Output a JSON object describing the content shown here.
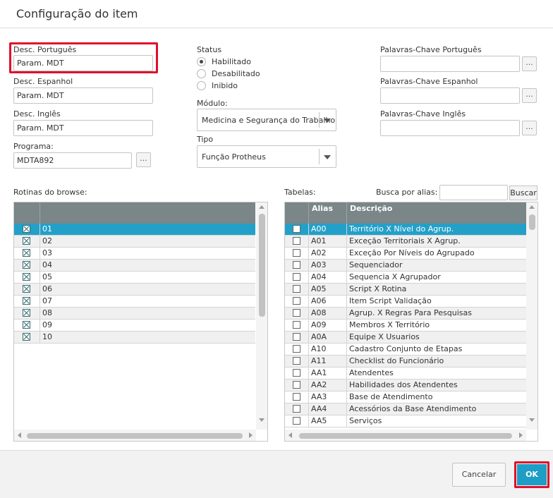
{
  "dialog": {
    "title": "Configuração do item"
  },
  "form": {
    "desc_pt": {
      "label": "Desc. Português",
      "value": "Param. MDT"
    },
    "desc_es": {
      "label": "Desc. Espanhol",
      "value": "Param. MDT"
    },
    "desc_en": {
      "label": "Desc. Inglês",
      "value": "Param. MDT"
    },
    "programa": {
      "label": "Programa:",
      "value": "MDTA892",
      "lookup": "..."
    },
    "status": {
      "label": "Status",
      "options": [
        "Habilitado",
        "Desabilitado",
        "Inibido"
      ],
      "selected": "Habilitado"
    },
    "modulo": {
      "label": "Módulo:",
      "value": "Medicina e Segurança do Trabalho"
    },
    "tipo": {
      "label": "Tipo",
      "value": "Função Protheus"
    },
    "kw_pt": {
      "label": "Palavras-Chave Português",
      "value": "",
      "lookup": "..."
    },
    "kw_es": {
      "label": "Palavras-Chave Espanhol",
      "value": "",
      "lookup": "..."
    },
    "kw_en": {
      "label": "Palavras-Chave Inglês",
      "value": "",
      "lookup": "..."
    }
  },
  "rotinas": {
    "label": "Rotinas do browse:",
    "rows": [
      {
        "value": "01",
        "checked": true,
        "selected": true
      },
      {
        "value": "02",
        "checked": true
      },
      {
        "value": "03",
        "checked": true
      },
      {
        "value": "04",
        "checked": true
      },
      {
        "value": "05",
        "checked": true
      },
      {
        "value": "06",
        "checked": true
      },
      {
        "value": "07",
        "checked": true
      },
      {
        "value": "08",
        "checked": true
      },
      {
        "value": "09",
        "checked": true
      },
      {
        "value": "10",
        "checked": true
      }
    ]
  },
  "tabelas": {
    "label": "Tabelas:",
    "search_label": "Busca por alias:",
    "search_value": "",
    "search_button": "Buscar",
    "columns": {
      "alias": "Alias",
      "descricao": "Descrição"
    },
    "rows": [
      {
        "alias": "A00",
        "descricao": "Território X Nível do Agrup.",
        "selected": true
      },
      {
        "alias": "A01",
        "descricao": "Exceção Territoriais X Agrup."
      },
      {
        "alias": "A02",
        "descricao": "Exceção Por Níveis do Agrupado"
      },
      {
        "alias": "A03",
        "descricao": "Sequenciador"
      },
      {
        "alias": "A04",
        "descricao": "Sequencia X Agrupador"
      },
      {
        "alias": "A05",
        "descricao": "Script X Rotina"
      },
      {
        "alias": "A06",
        "descricao": "Item Script Validação"
      },
      {
        "alias": "A08",
        "descricao": "Agrup. X Regras Para Pesquisas"
      },
      {
        "alias": "A09",
        "descricao": "Membros X Território"
      },
      {
        "alias": "A0A",
        "descricao": "Equipe X Usuarios"
      },
      {
        "alias": "A10",
        "descricao": "Cadastro Conjunto de Etapas"
      },
      {
        "alias": "A11",
        "descricao": "Checklist do Funcionário"
      },
      {
        "alias": "AA1",
        "descricao": "Atendentes"
      },
      {
        "alias": "AA2",
        "descricao": "Habilidades dos Atendentes"
      },
      {
        "alias": "AA3",
        "descricao": "Base de Atendimento"
      },
      {
        "alias": "AA4",
        "descricao": "Acessórios da Base Atendimento"
      },
      {
        "alias": "AA5",
        "descricao": "Serviços"
      }
    ]
  },
  "footer": {
    "cancel_label": "Cancelar",
    "ok_label": "OK"
  },
  "colors": {
    "accent": "#1e9ec6",
    "selected_row": "#23a0c8",
    "grid_header": "#7a8688",
    "highlight": "#e0102a"
  }
}
